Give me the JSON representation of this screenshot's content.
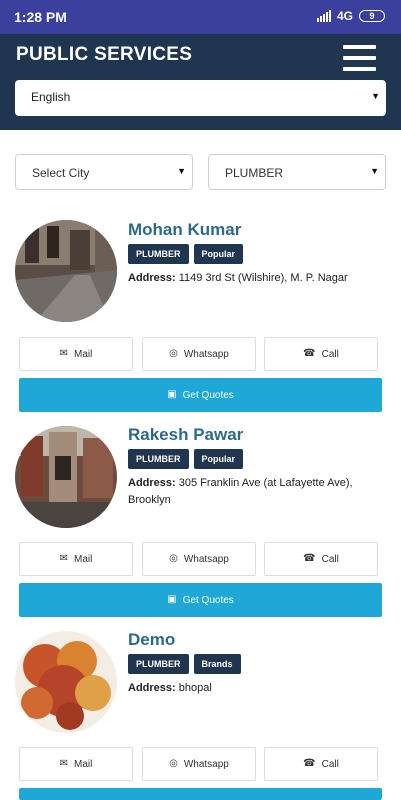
{
  "status_bar": {
    "time": "1:28 PM",
    "network": "4G",
    "battery": "9"
  },
  "header": {
    "title": "PUBLIC SERVICES"
  },
  "language_select": {
    "value": "English"
  },
  "filters": {
    "city": "Select City",
    "category": "PLUMBER"
  },
  "listings": [
    {
      "name": "Mohan Kumar",
      "badges": [
        "PLUMBER",
        "Popular"
      ],
      "address_label": "Address:",
      "address": "1149 3rd St (Wilshire), M. P. Nagar"
    },
    {
      "name": "Rakesh Pawar",
      "badges": [
        "PLUMBER",
        "Popular"
      ],
      "address_label": "Address:",
      "address": "305 Franklin Ave (at Lafayette Ave), Brooklyn"
    },
    {
      "name": "Demo",
      "badges": [
        "PLUMBER",
        "Brands"
      ],
      "address_label": "Address:",
      "address": "bhopal"
    }
  ],
  "actions": {
    "mail": "Mail",
    "whatsapp": "Whatsapp",
    "call": "Call",
    "quotes": "Get Quotes"
  },
  "colors": {
    "status_bar": "#3b3f9d",
    "header": "#1f3550",
    "accent": "#1fa7d8",
    "name": "#2e6a88"
  }
}
